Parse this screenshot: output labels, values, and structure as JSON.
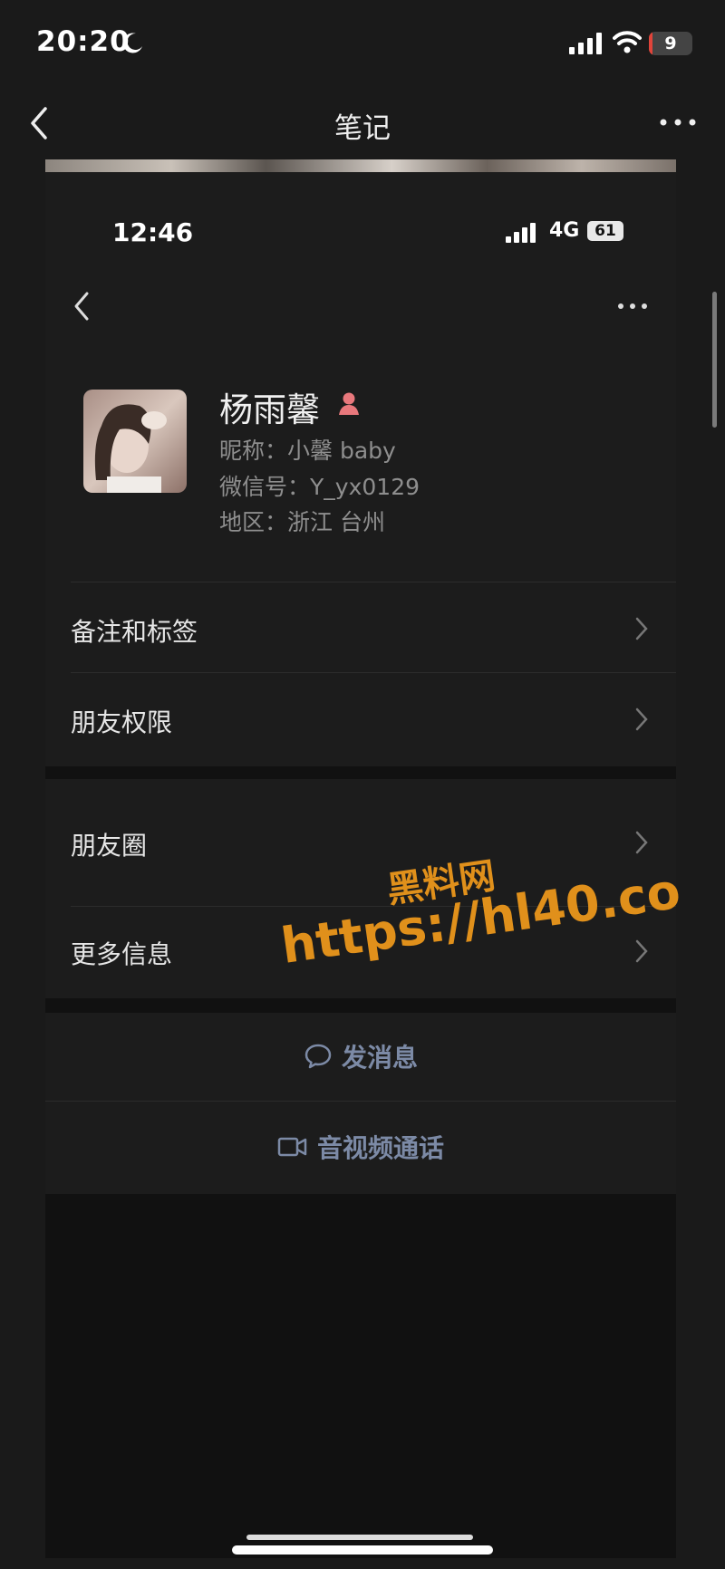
{
  "status": {
    "time": "20:20",
    "battery": "9",
    "battery_level": 0.09
  },
  "nav": {
    "title": "笔记"
  },
  "inner": {
    "status": {
      "time": "12:46",
      "network": "4G",
      "battery": "61"
    },
    "profile": {
      "name": "杨雨馨",
      "nickname_label": "昵称：",
      "nickname": "小馨 baby",
      "wechat_label": "微信号：",
      "wechat_id": "Y_yx0129",
      "region_label": "地区：",
      "region": "浙江 台州"
    },
    "rows": [
      {
        "label": "备注和标签"
      },
      {
        "label": "朋友权限"
      },
      {
        "label": "朋友圈"
      },
      {
        "label": "更多信息"
      }
    ],
    "actions": {
      "message": "发消息",
      "call": "音视频通话"
    }
  },
  "watermark": {
    "line1": "黑料网",
    "line2": "https://hl40.co"
  },
  "icons": [
    "moon-icon",
    "signal-icon",
    "wifi-icon",
    "back-icon",
    "more-icon",
    "gender-icon",
    "chevron-right-icon",
    "chat-bubble-icon",
    "video-camera-icon"
  ]
}
